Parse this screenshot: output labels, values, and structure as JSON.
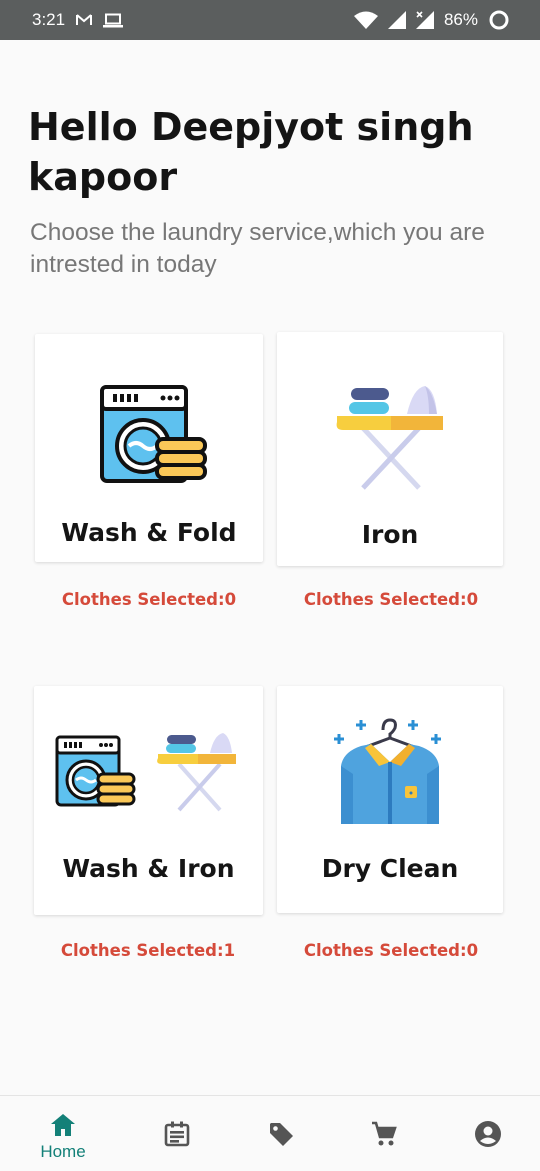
{
  "status_bar": {
    "time": "3:21",
    "battery": "86%",
    "icons": [
      "gmail-icon",
      "laptop-icon",
      "wifi-icon",
      "signal-icon",
      "signal-x-icon",
      "battery-ring-icon"
    ]
  },
  "greeting": "Hello Deepjyot singh kapoor",
  "subtitle": "Choose the laundry service,which you are intrested in today",
  "services": [
    {
      "name": "Wash & Fold",
      "icon": "washing-machine-icon",
      "selected_text": "Clothes Selected:0"
    },
    {
      "name": "Iron",
      "icon": "ironing-board-icon",
      "selected_text": "Clothes Selected:0"
    },
    {
      "name": "Wash & Iron",
      "icon": "washer-and-iron-icon",
      "selected_text": "Clothes Selected:1"
    },
    {
      "name": "Dry Clean",
      "icon": "shirt-on-hanger-icon",
      "selected_text": "Clothes Selected:0"
    }
  ],
  "bottom_nav": {
    "items": [
      {
        "icon": "home-icon",
        "label": "Home",
        "active": true
      },
      {
        "icon": "calendar-icon",
        "label": ""
      },
      {
        "icon": "tag-icon",
        "label": ""
      },
      {
        "icon": "cart-icon",
        "label": ""
      },
      {
        "icon": "account-icon",
        "label": ""
      }
    ]
  },
  "colors": {
    "status_bar": "#5b5e5e",
    "accent": "#138078",
    "selected_text": "#d54a3a",
    "subtitle": "#777777",
    "background": "#fafafa"
  }
}
